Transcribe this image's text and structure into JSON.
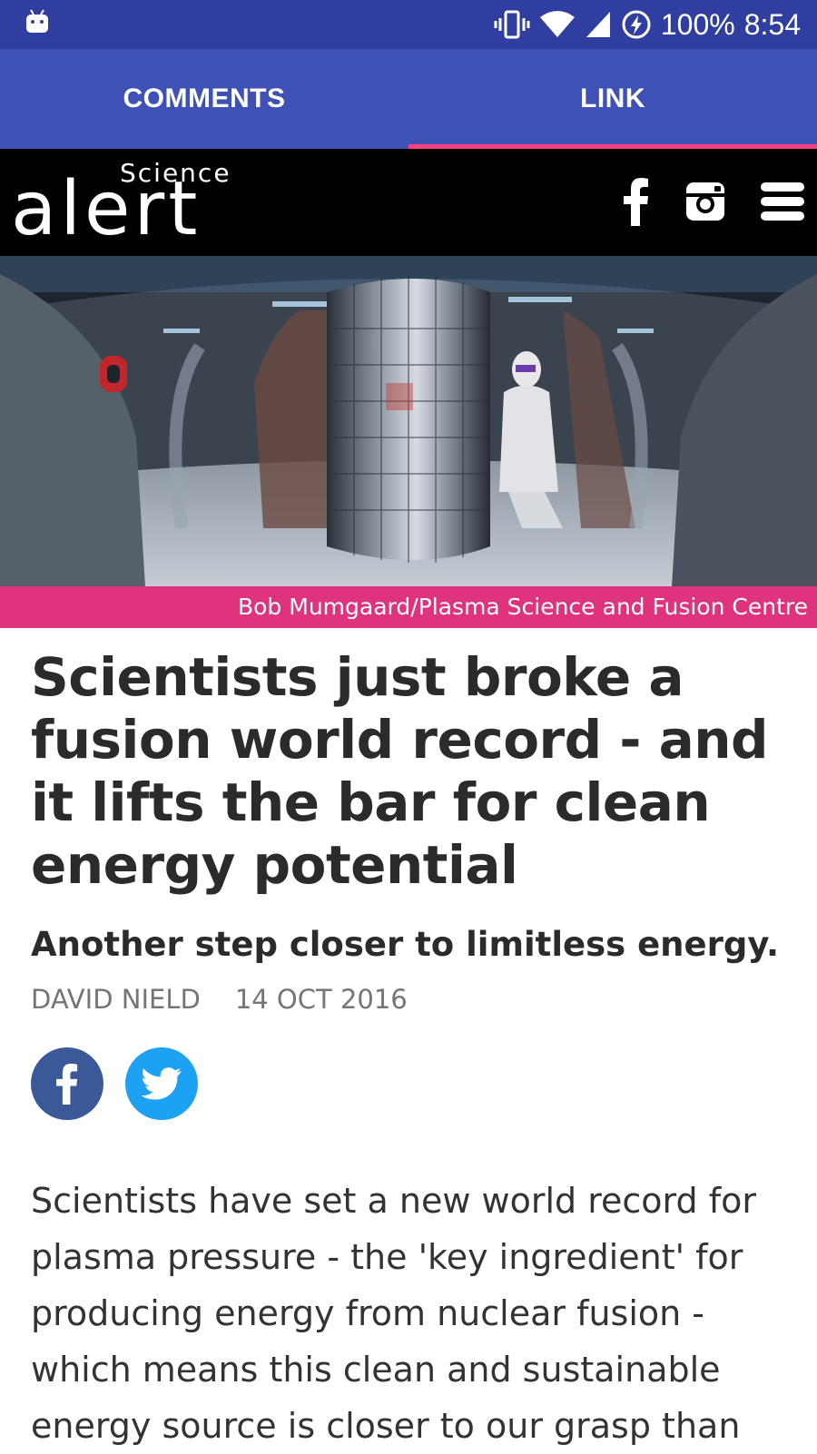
{
  "status_bar": {
    "battery": "100%",
    "time": "8:54"
  },
  "tabs": [
    {
      "label": "COMMENTS",
      "active": false
    },
    {
      "label": "LINK",
      "active": true
    }
  ],
  "site": {
    "logo_small": "Science",
    "logo_big": "alert",
    "header_icons": [
      "facebook-icon",
      "instagram-icon",
      "menu-icon"
    ]
  },
  "article": {
    "image_caption": "Bob Mumgaard/Plasma Science and Fusion Centre",
    "headline": "Scientists just broke a fusion world record - and it lifts the bar for clean energy potential",
    "subtitle": "Another step closer to limitless energy.",
    "author": "DAVID NIELD",
    "date": "14 OCT 2016",
    "share_icons": [
      "facebook-share-icon",
      "twitter-share-icon"
    ],
    "body": "Scientists have set a new world record for plasma pressure - the 'key ingredient' for producing energy from nuclear fusion - which means this clean and sustainable energy source is closer to our grasp than"
  },
  "colors": {
    "status_bar": "#303f9f",
    "tab_bar": "#3f51b5",
    "tab_indicator": "#ff4081",
    "caption_bar": "#e0337d",
    "facebook": "#3b5998",
    "twitter": "#1da1f2"
  }
}
